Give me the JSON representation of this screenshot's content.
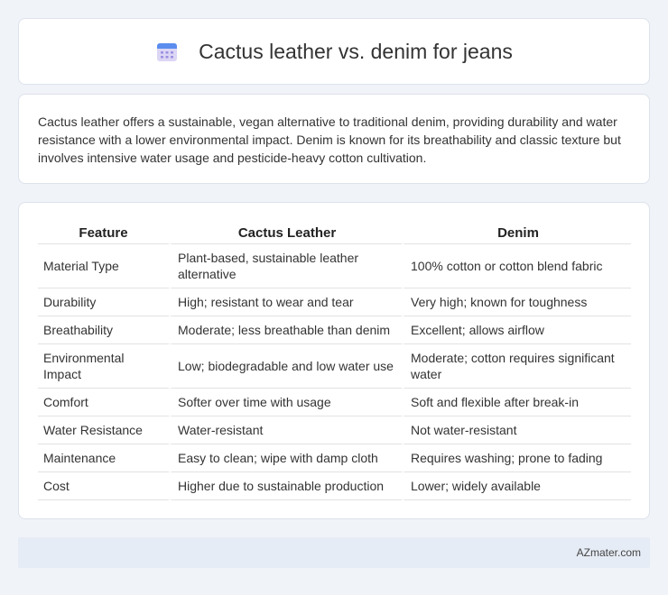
{
  "header": {
    "title": "Cactus leather vs. denim for jeans",
    "icon": "calendar-icon"
  },
  "description": "Cactus leather offers a sustainable, vegan alternative to traditional denim, providing durability and water resistance with a lower environmental impact. Denim is known for its breathability and classic texture but involves intensive water usage and pesticide-heavy cotton cultivation.",
  "table": {
    "headers": [
      "Feature",
      "Cactus Leather",
      "Denim"
    ],
    "rows": [
      [
        "Material Type",
        "Plant-based, sustainable leather alternative",
        "100% cotton or cotton blend fabric"
      ],
      [
        "Durability",
        "High; resistant to wear and tear",
        "Very high; known for toughness"
      ],
      [
        "Breathability",
        "Moderate; less breathable than denim",
        "Excellent; allows airflow"
      ],
      [
        "Environmental Impact",
        "Low; biodegradable and low water use",
        "Moderate; cotton requires significant water"
      ],
      [
        "Comfort",
        "Softer over time with usage",
        "Soft and flexible after break-in"
      ],
      [
        "Water Resistance",
        "Water-resistant",
        "Not water-resistant"
      ],
      [
        "Maintenance",
        "Easy to clean; wipe with damp cloth",
        "Requires washing; prone to fading"
      ],
      [
        "Cost",
        "Higher due to sustainable production",
        "Lower; widely available"
      ]
    ]
  },
  "footer": {
    "text": "AZmater.com"
  }
}
